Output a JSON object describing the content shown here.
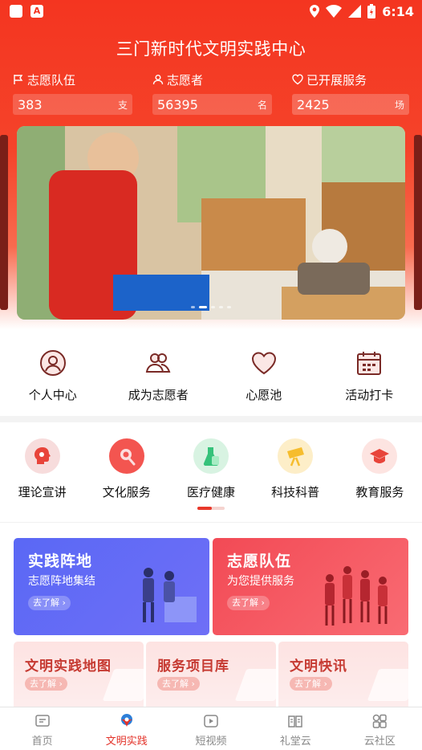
{
  "status_bar": {
    "time": "6:14"
  },
  "app_title": "三门新时代文明实践中心",
  "stats": [
    {
      "icon": "flag-icon",
      "label": "志愿队伍",
      "value": "383",
      "unit": "支"
    },
    {
      "icon": "person-icon",
      "label": "志愿者",
      "value": "56395",
      "unit": "名"
    },
    {
      "icon": "heart-icon",
      "label": "已开展服务",
      "value": "2425",
      "unit": "场"
    }
  ],
  "quick_menu": [
    {
      "icon": "person-circle-icon",
      "label": "个人中心"
    },
    {
      "icon": "people-icon",
      "label": "成为志愿者"
    },
    {
      "icon": "heart-icon",
      "label": "心愿池"
    },
    {
      "icon": "calendar-icon",
      "label": "活动打卡"
    }
  ],
  "categories": [
    {
      "icon": "head-gear-icon",
      "label": "理论宣讲",
      "color": "#f5dede"
    },
    {
      "icon": "brush-icon",
      "label": "文化服务",
      "color": "#f35550"
    },
    {
      "icon": "flask-icon",
      "label": "医疗健康",
      "color": "#d8f3e2"
    },
    {
      "icon": "telescope-icon",
      "label": "科技科普",
      "color": "#fdeec8"
    },
    {
      "icon": "graduation-cap-icon",
      "label": "教育服务",
      "color": "#fde4e1"
    }
  ],
  "feature_cards": [
    {
      "title": "实践阵地",
      "subtitle": "志愿阵地集结",
      "button": "去了解"
    },
    {
      "title": "志愿队伍",
      "subtitle": "为您提供服务",
      "button": "去了解"
    }
  ],
  "small_cards": [
    {
      "title": "文明实践地图",
      "button": "去了解"
    },
    {
      "title": "服务项目库",
      "button": "去了解"
    },
    {
      "title": "文明快讯",
      "button": "去了解"
    }
  ],
  "bottom_nav": [
    {
      "icon": "home-icon",
      "label": "首页",
      "active": false
    },
    {
      "icon": "civilization-icon",
      "label": "文明实践",
      "active": true
    },
    {
      "icon": "video-icon",
      "label": "短视频",
      "active": false
    },
    {
      "icon": "book-icon",
      "label": "礼堂云",
      "active": false
    },
    {
      "icon": "grid-icon",
      "label": "云社区",
      "active": false
    }
  ],
  "colors": {
    "primary": "#e8382a",
    "header": "#f43520",
    "blue_card": "#5a68f5",
    "red_card": "#f24a55"
  }
}
